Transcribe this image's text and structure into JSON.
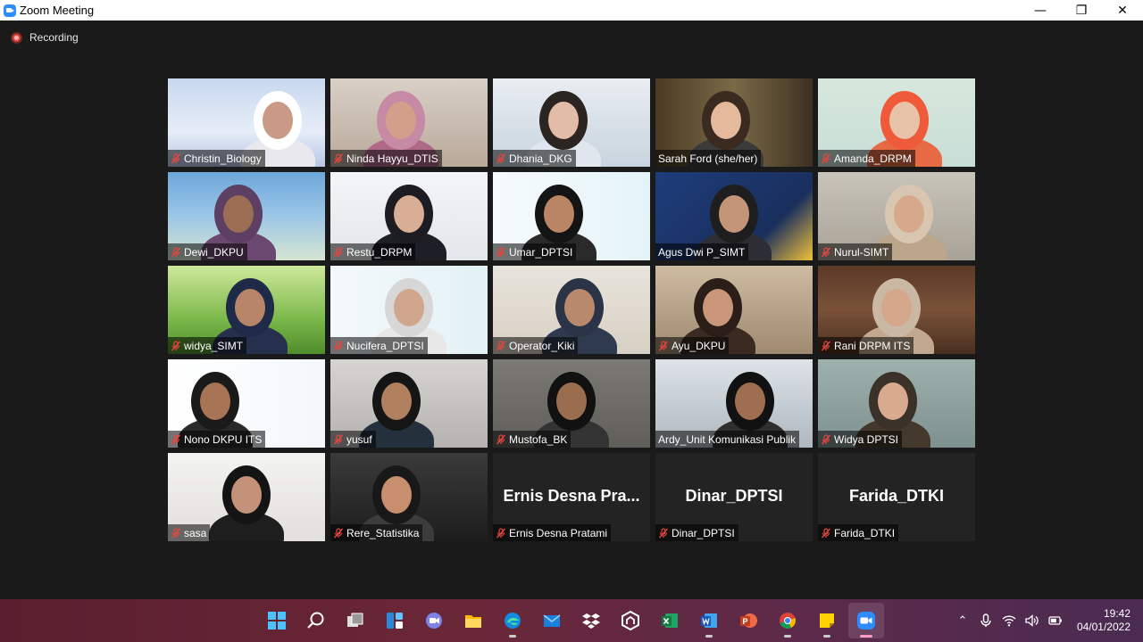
{
  "window": {
    "title": "Zoom Meeting"
  },
  "recording": {
    "label": "Recording"
  },
  "participants": [
    {
      "name": "Christin_Biology",
      "muted": true
    },
    {
      "name": "Ninda Hayyu_DTIS",
      "muted": true
    },
    {
      "name": "Dhania_DKG",
      "muted": true
    },
    {
      "name": "Sarah Ford (she/her)",
      "muted": false,
      "speaking": true
    },
    {
      "name": "Amanda_DRPM",
      "muted": true
    },
    {
      "name": "Dewi_DKPU",
      "muted": true
    },
    {
      "name": "Restu_DRPM",
      "muted": true
    },
    {
      "name": "Umar_DPTSI",
      "muted": true
    },
    {
      "name": "Agus Dwi P_SIMT",
      "muted": false
    },
    {
      "name": "Nurul-SIMT",
      "muted": true
    },
    {
      "name": "widya_SIMT",
      "muted": true
    },
    {
      "name": "Nucifera_DPTSI",
      "muted": true
    },
    {
      "name": "Operator_Kiki",
      "muted": true
    },
    {
      "name": "Ayu_DKPU",
      "muted": true
    },
    {
      "name": "Rani DRPM ITS",
      "muted": true
    },
    {
      "name": "Nono DKPU ITS",
      "muted": true
    },
    {
      "name": "yusuf",
      "muted": true
    },
    {
      "name": "Mustofa_BK",
      "muted": true
    },
    {
      "name": "Ardy_Unit Komunikasi Publik",
      "muted": false
    },
    {
      "name": "Widya DPTSI",
      "muted": true
    },
    {
      "name": "sasa",
      "muted": true
    },
    {
      "name": "Rere_Statistika",
      "muted": true
    },
    {
      "name": "Ernis Desna Pratami",
      "muted": true,
      "video_off": true,
      "display": "Ernis  Desna  Pra..."
    },
    {
      "name": "Dinar_DPTSI",
      "muted": true,
      "video_off": true,
      "display": "Dinar_DPTSI"
    },
    {
      "name": "Farida_DTKI",
      "muted": true,
      "video_off": true,
      "display": "Farida_DTKI"
    }
  ],
  "taskbar": {
    "apps": [
      "start-icon",
      "search-icon",
      "task-view-icon",
      "widgets-icon",
      "teams-chat-icon",
      "file-explorer-icon",
      "edge-icon",
      "mail-icon",
      "dropbox-icon",
      "app-hexagon-icon",
      "excel-icon",
      "word-icon",
      "powerpoint-icon",
      "chrome-icon",
      "sticky-notes-icon",
      "zoom-icon"
    ],
    "clock": {
      "time": "19:42",
      "date": "04/01/2022"
    }
  },
  "colors": {
    "speaking_border": "#e6e14e",
    "mute_red": "#e5463e",
    "zoom_blue": "#2d8cff"
  }
}
